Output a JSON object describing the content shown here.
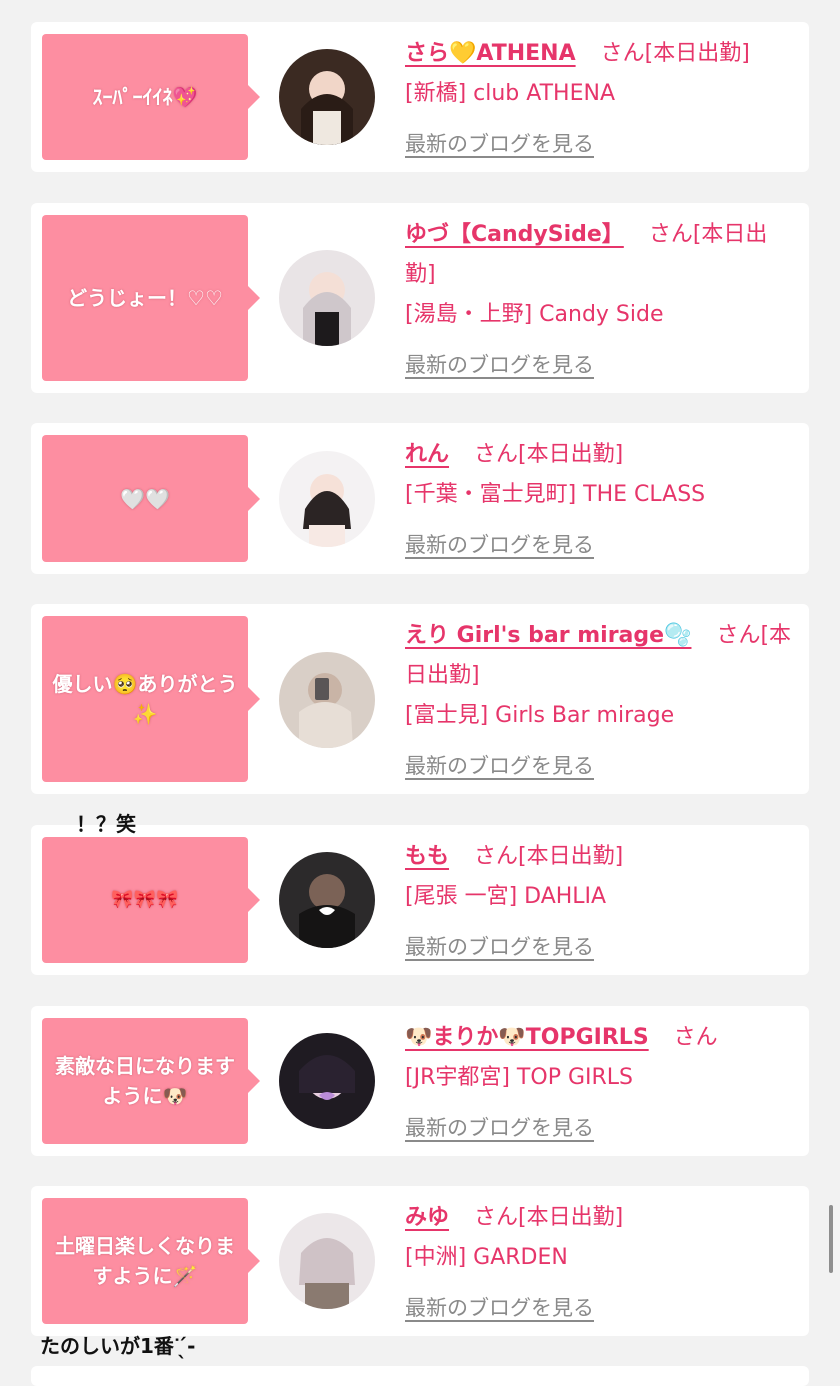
{
  "colors": {
    "bubble": "#fd8ea1",
    "accent": "#e6356a",
    "link_gray": "#8a8a8a",
    "page_bg": "#f2f2f2"
  },
  "cards": [
    {
      "message": "ｽｰﾊﾟｰｲｲﾈ💖",
      "name": "さら💛ATHENA",
      "suffix": "さん[本日出勤]",
      "shop": "[新橋] club ATHENA",
      "blog_link": "最新のブログを見る",
      "avatar_icon": "girl-portrait-photo"
    },
    {
      "message": "どうじょー！♡♡",
      "name": "ゆづ【CandySide】",
      "suffix": "さん[本日出勤]",
      "shop": "[湯島・上野] Candy Side",
      "blog_link": "最新のブログを見る",
      "avatar_icon": "girl-portrait-photo"
    },
    {
      "message": "🤍🤍",
      "name": "れん",
      "suffix": "さん[本日出勤]",
      "shop": "[千葉・富士見町] THE CLASS",
      "blog_link": "最新のブログを見る",
      "avatar_icon": "girl-portrait-photo"
    },
    {
      "message": "優しい🥺ありがとう✨",
      "name": "えり Girl's bar mirage🫧",
      "suffix": "さん[本日出勤]",
      "shop": "[富士見] Girls Bar mirage",
      "blog_link": "最新のブログを見る",
      "avatar_icon": "girl-portrait-photo"
    },
    {
      "message": "🎀🎀🎀",
      "name": "もも",
      "suffix": "さん[本日出勤]",
      "shop": "[尾張 一宮] DAHLIA",
      "blog_link": "最新のブログを見る",
      "avatar_icon": "girl-portrait-photo"
    },
    {
      "message": "素敵な日になりますように🐶",
      "name": "🐶まりか🐶TOPGIRLS",
      "suffix": "さん",
      "shop": "[JR宇都宮] TOP GIRLS",
      "blog_link": "最新のブログを見る",
      "avatar_icon": "girl-portrait-photo"
    },
    {
      "message": "土曜日楽しくなりますように🪄",
      "name": "みゆ",
      "suffix": "さん[本日出勤]",
      "shop": "[中洲] GARDEN",
      "blog_link": "最新のブログを見る",
      "avatar_icon": "girl-portrait-photo"
    }
  ],
  "overlays": {
    "text_1": "！？笑",
    "text_2": "たのしいが1番ᐝ ̖́-"
  }
}
